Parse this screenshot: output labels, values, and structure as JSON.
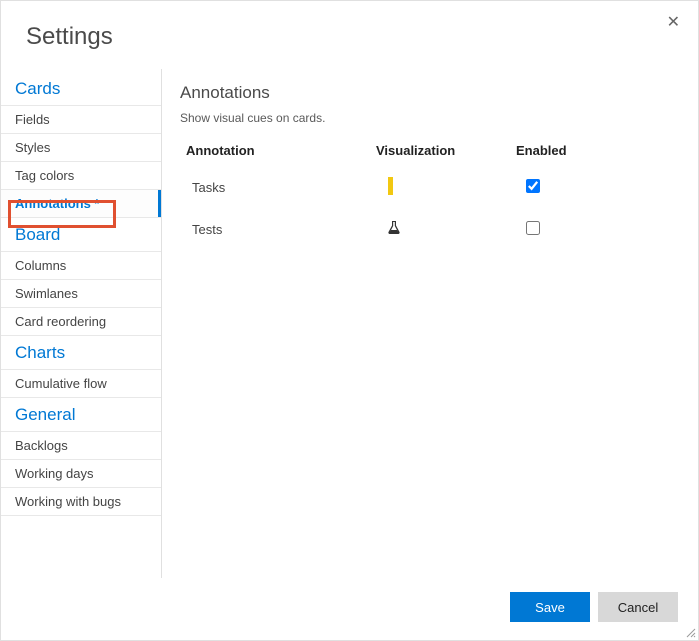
{
  "dialog": {
    "title": "Settings"
  },
  "sidebar": {
    "sections": [
      {
        "title": "Cards",
        "items": [
          "Fields",
          "Styles",
          "Tag colors",
          "Annotations *"
        ]
      },
      {
        "title": "Board",
        "items": [
          "Columns",
          "Swimlanes",
          "Card reordering"
        ]
      },
      {
        "title": "Charts",
        "items": [
          "Cumulative flow"
        ]
      },
      {
        "title": "General",
        "items": [
          "Backlogs",
          "Working days",
          "Working with bugs"
        ]
      }
    ],
    "active": "Annotations *"
  },
  "main": {
    "title": "Annotations",
    "description": "Show visual cues on cards.",
    "columns": {
      "annotation": "Annotation",
      "visualization": "Visualization",
      "enabled": "Enabled"
    },
    "rows": [
      {
        "name": "Tasks",
        "viz": "bar",
        "enabled": true
      },
      {
        "name": "Tests",
        "viz": "flask",
        "enabled": false
      }
    ]
  },
  "footer": {
    "save": "Save",
    "cancel": "Cancel"
  }
}
